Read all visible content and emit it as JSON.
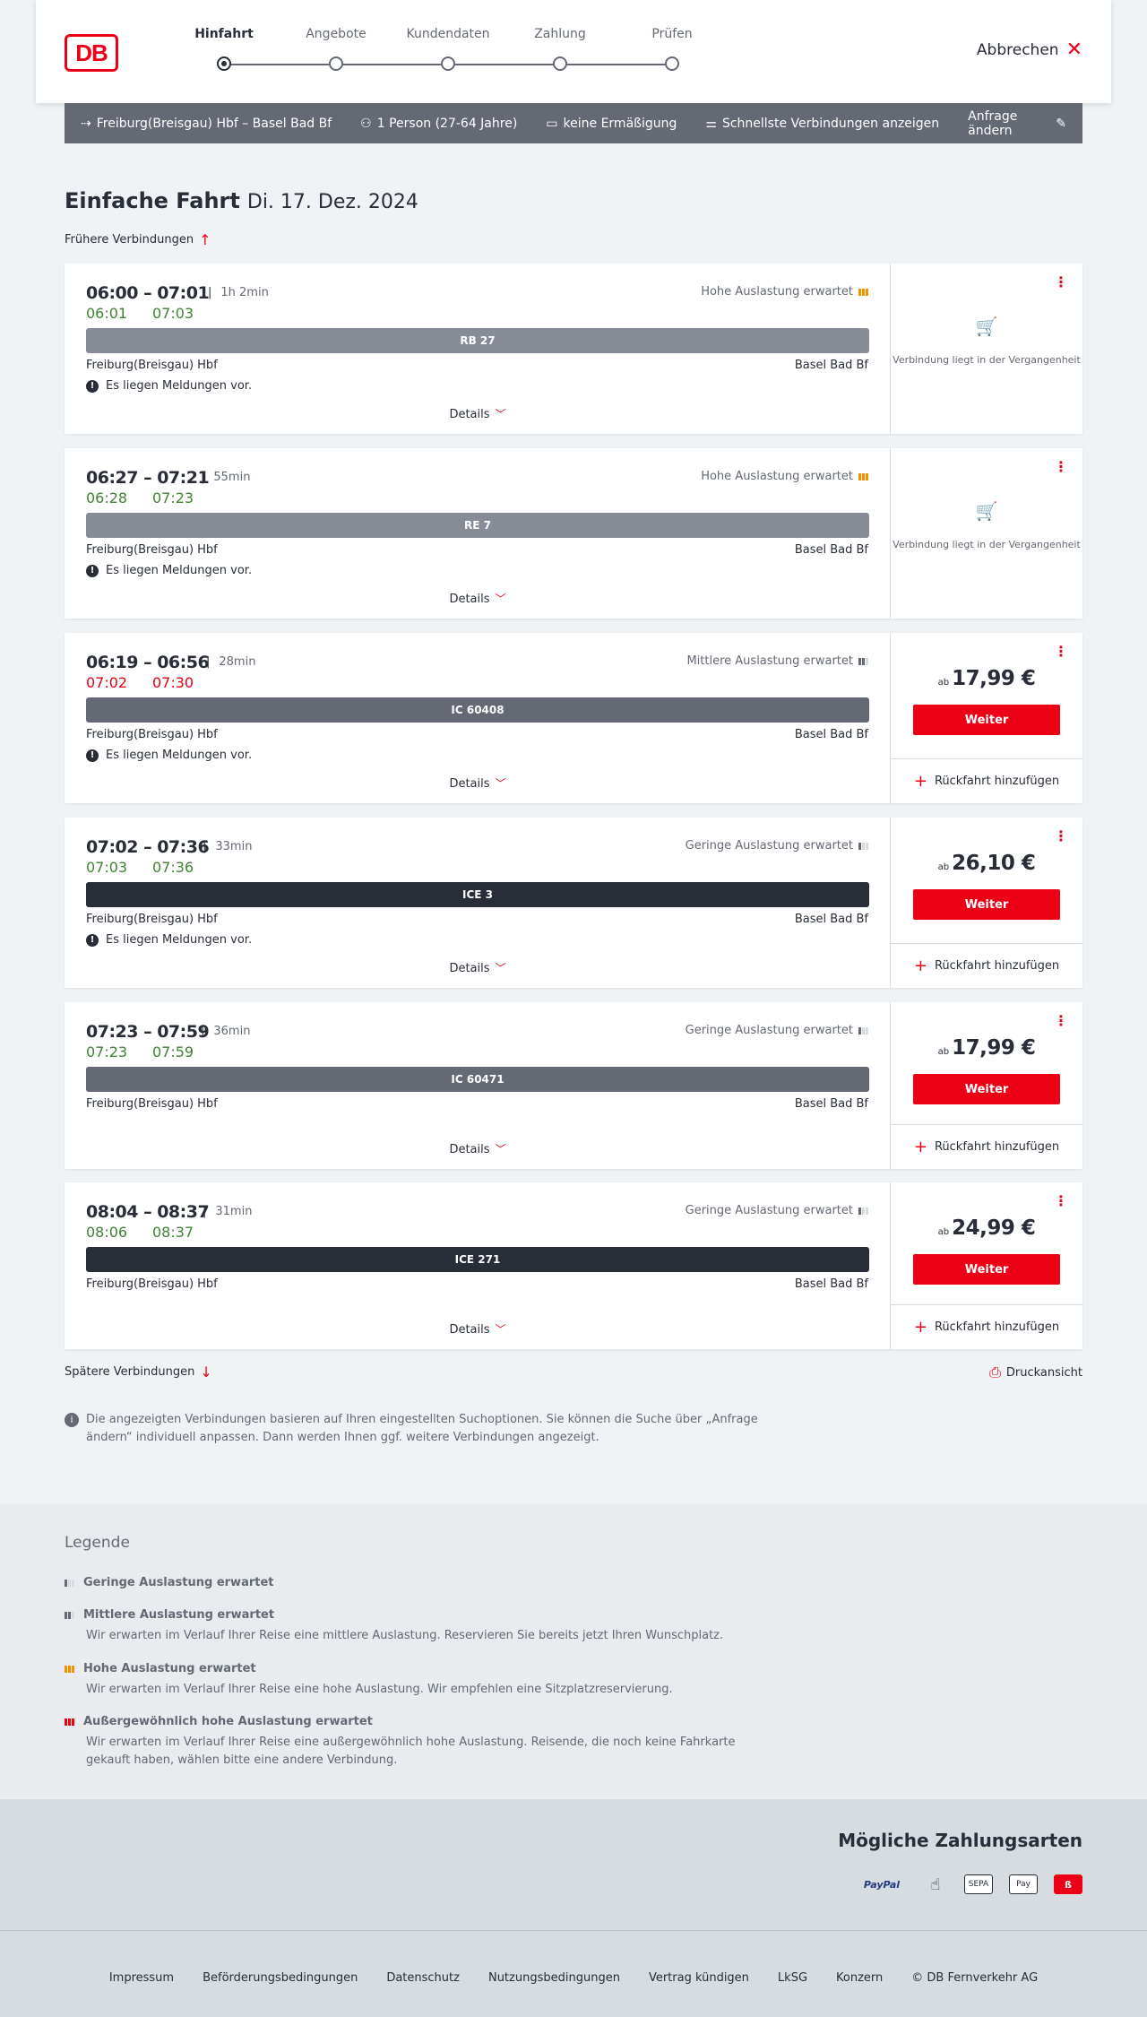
{
  "header": {
    "logo": "DB",
    "steps": [
      "Hinfahrt",
      "Angebote",
      "Kundendaten",
      "Zahlung",
      "Prüfen"
    ],
    "cancel_label": "Abbrechen"
  },
  "searchbar": {
    "route": "Freiburg(Breisgau) Hbf – Basel Bad Bf",
    "passengers": "1 Person (27-64 Jahre)",
    "discount": "keine Ermäßigung",
    "fastest": "Schnellste Verbindungen anzeigen",
    "edit": "Anfrage ändern"
  },
  "page": {
    "title": "Einfache Fahrt",
    "date": "Di. 17. Dez. 2024",
    "earlier": "Frühere Verbindungen",
    "later": "Spätere Verbindungen",
    "print": "Druckansicht",
    "info": "Die angezeigten Verbindungen basieren auf Ihren eingestellten Suchoptionen. Sie können die Suche über „Anfrage ändern“ individuell anpassen. Dann werden Ihnen ggf. weitere Verbindungen angezeigt."
  },
  "labels": {
    "details": "Details",
    "past": "Verbindung liegt in der Vergangenheit",
    "ab": "ab",
    "weiter": "Weiter",
    "return": "Rückfahrt hinzufügen",
    "messages": "Es liegen Meldungen vor."
  },
  "connections": [
    {
      "times": "06:00 – 07:01",
      "duration": "1h 2min",
      "rt_dep": "06:01",
      "rt_arr": "07:03",
      "rt_color": "#408335",
      "load": "Hohe Auslastung erwartet",
      "train": "RB 27",
      "from": "Freiburg(Breisgau) Hbf",
      "to": "Basel Bad Bf"
    },
    {
      "times": "06:27 – 07:21",
      "duration": "55min",
      "rt_dep": "06:28",
      "rt_arr": "07:23",
      "rt_color": "#408335",
      "load": "Hohe Auslastung erwartet",
      "train": "RE 7",
      "from": "Freiburg(Breisgau) Hbf",
      "to": "Basel Bad Bf"
    },
    {
      "times": "06:19 – 06:56",
      "duration": "28min",
      "rt_dep": "07:02",
      "rt_arr": "07:30",
      "rt_color": "#ec0016",
      "load": "Mittlere Auslastung erwartet",
      "train": "IC 60408",
      "from": "Freiburg(Breisgau) Hbf",
      "to": "Basel Bad Bf",
      "price": "17,99 €"
    },
    {
      "times": "07:02 – 07:36",
      "duration": "33min",
      "rt_dep": "07:03",
      "rt_arr": "07:36",
      "rt_color": "#408335",
      "load": "Geringe Auslastung erwartet",
      "train": "ICE 3",
      "from": "Freiburg(Breisgau) Hbf",
      "to": "Basel Bad Bf",
      "price": "26,10 €"
    },
    {
      "times": "07:23 – 07:59",
      "duration": "36min",
      "rt_dep": "07:23",
      "rt_arr": "07:59",
      "rt_color": "#408335",
      "load": "Geringe Auslastung erwartet",
      "train": "IC 60471",
      "from": "Freiburg(Breisgau) Hbf",
      "to": "Basel Bad Bf",
      "price": "17,99 €"
    },
    {
      "times": "08:04 – 08:37",
      "duration": "31min",
      "rt_dep": "08:06",
      "rt_arr": "08:37",
      "rt_color": "#408335",
      "load": "Geringe Auslastung erwartet",
      "train": "ICE 271",
      "from": "Freiburg(Breisgau) Hbf",
      "to": "Basel Bad Bf",
      "price": "24,99 €"
    }
  ],
  "legend": {
    "title": "Legende",
    "items": [
      {
        "title": "Geringe Auslastung erwartet",
        "desc": ""
      },
      {
        "title": "Mittlere Auslastung erwartet",
        "desc": "Wir erwarten im Verlauf Ihrer Reise eine mittlere Auslastung. Reservieren Sie bereits jetzt Ihren Wunschplatz."
      },
      {
        "title": "Hohe Auslastung erwartet",
        "desc": "Wir erwarten im Verlauf Ihrer Reise eine hohe Auslastung. Wir empfehlen eine Sitzplatzreservierung."
      },
      {
        "title": "Außergewöhnlich hohe Auslastung erwartet",
        "desc": "Wir erwarten im Verlauf Ihrer Reise eine außergewöhnlich hohe Auslastung. Reisende, die noch keine Fahrkarte gekauft haben, wählen bitte eine andere Verbindung."
      }
    ]
  },
  "payments": {
    "title": "Mögliche Zahlungsarten",
    "paypal": "PayPal",
    "sepa": "SEPA",
    "applepay": " Pay"
  },
  "footer": {
    "links": [
      "Impressum",
      "Beförderungsbedingungen",
      "Datenschutz",
      "Nutzungsbedingungen",
      "Vertrag kündigen",
      "LkSG",
      "Konzern",
      "© DB Fernverkehr AG"
    ]
  }
}
